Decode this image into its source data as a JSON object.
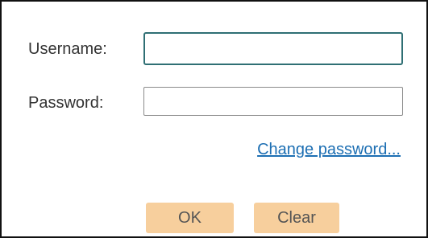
{
  "form": {
    "username_label": "Username:",
    "username_value": "",
    "password_label": "Password:",
    "password_value": "",
    "change_password_link": "Change password...",
    "ok_label": "OK",
    "clear_label": "Clear"
  },
  "colors": {
    "button_bg": "#f7cf9d",
    "link": "#1d6fb3",
    "focused_border": "#2f6f74"
  }
}
